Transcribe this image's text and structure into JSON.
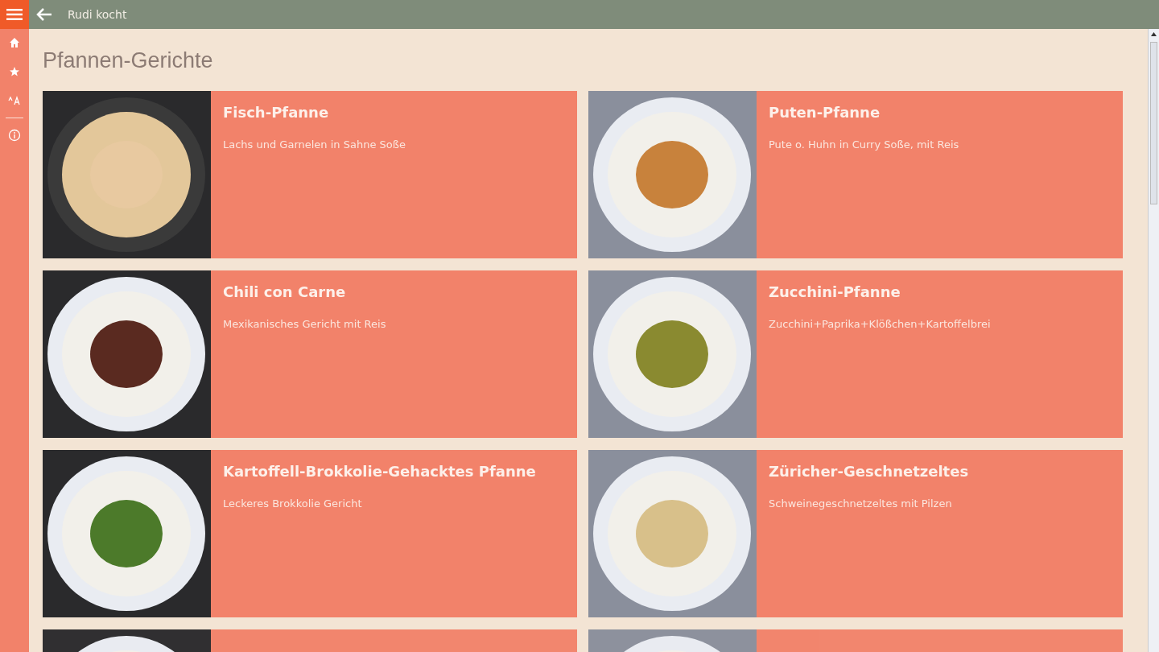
{
  "app_bar": {
    "title": "Rudi kocht"
  },
  "page": {
    "heading": "Pfannen-Gerichte"
  },
  "recipes": [
    {
      "title": "Fisch-Pfanne",
      "description": "Lachs und Garnelen in Sahne Soße"
    },
    {
      "title": "Puten-Pfanne",
      "description": "Pute o. Huhn in Curry Soße, mit Reis"
    },
    {
      "title": "Chili con Carne",
      "description": "Mexikanisches Gericht mit Reis"
    },
    {
      "title": "Zucchini-Pfanne",
      "description": "Zucchini+Paprika+Klößchen+Kartoffelbrei"
    },
    {
      "title": "Kartoffell-Brokkolie-Gehacktes Pfanne",
      "description": "Leckeres Brokkolie Gericht"
    },
    {
      "title": "Züricher-Geschnetzeltes",
      "description": "Schweinegeschnetzeltes mit Pilzen"
    },
    {
      "kind": "cut-off"
    },
    {
      "kind": "cut-off"
    }
  ]
}
